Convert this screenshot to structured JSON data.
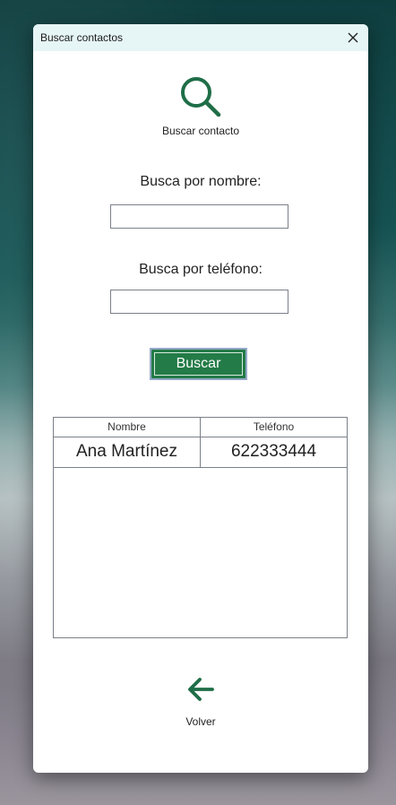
{
  "window": {
    "title": "Buscar contactos"
  },
  "header": {
    "icon": "search-icon",
    "label": "Buscar contacto"
  },
  "form": {
    "name_label": "Busca por nombre:",
    "name_value": "",
    "phone_label": "Busca por teléfono:",
    "phone_value": "",
    "search_button_label": "Buscar"
  },
  "results": {
    "columns": [
      "Nombre",
      "Teléfono"
    ],
    "rows": [
      [
        "Ana Martínez",
        "622333444"
      ]
    ]
  },
  "footer": {
    "icon": "arrow-left-icon",
    "back_label": "Volver"
  },
  "colors": {
    "accent": "#237b47",
    "icon_green": "#1f6e48",
    "titlebar": "#e6f5f6"
  }
}
